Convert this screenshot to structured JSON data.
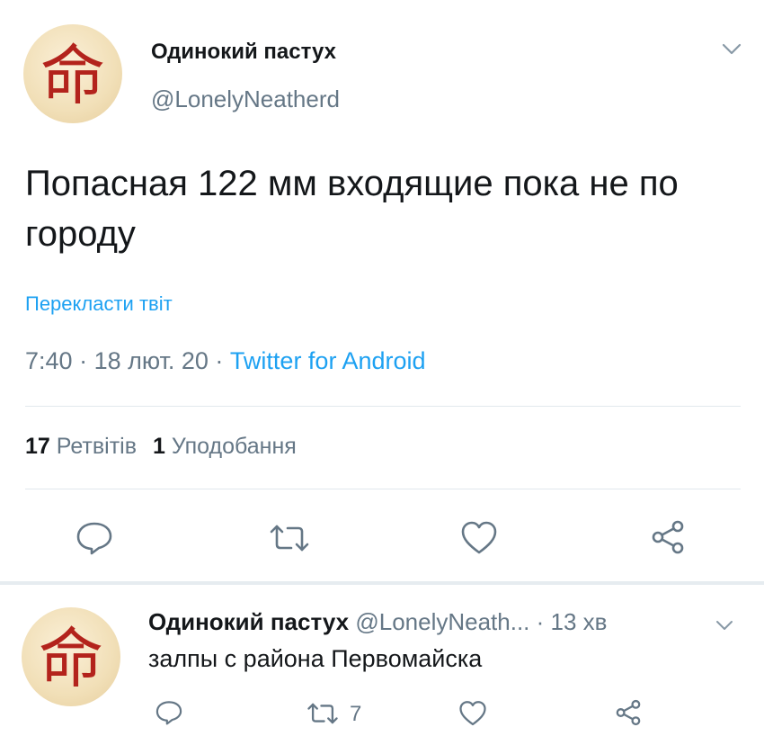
{
  "tweet": {
    "author_name": "Одинокий пастух",
    "author_handle": "@LonelyNeatherd",
    "text": "Попасная 122 мм входящие пока не по городу",
    "translate_link": "Перекласти твіт",
    "time": "7:40",
    "date": "18 лют. 20",
    "source": "Twitter for Android",
    "separator": " · ",
    "retweets_count": "17",
    "retweets_label": "Ретвітів",
    "likes_count": "1",
    "likes_label": "Уподобання",
    "avatar_glyph": "命"
  },
  "reply": {
    "author_name": "Одинокий пастух",
    "author_handle": "@LonelyNeath...",
    "time": "· 13 хв",
    "text": "залпы с района Первомайска",
    "retweet_count": "7"
  },
  "colors": {
    "accent": "#1da1f2",
    "secondary_text": "#657786",
    "primary_text": "#14171a",
    "divider": "#e1e8ed",
    "avatar_glyph": "#b3231c"
  },
  "icons": [
    "chevron-down-icon",
    "reply-icon",
    "retweet-icon",
    "like-icon",
    "share-icon"
  ]
}
